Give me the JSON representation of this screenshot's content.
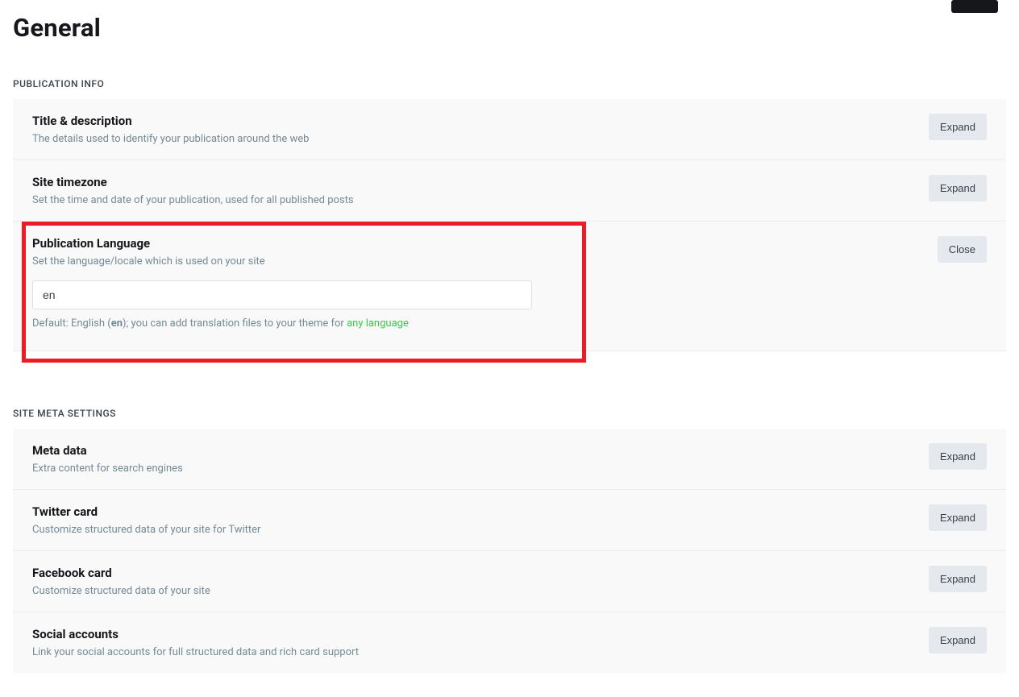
{
  "page": {
    "title": "General"
  },
  "topbar": {
    "save_label": ""
  },
  "sections": [
    {
      "label": "PUBLICATION INFO",
      "rows": [
        {
          "title": "Title & description",
          "desc": "The details used to identify your publication around the web",
          "action": "Expand"
        },
        {
          "title": "Site timezone",
          "desc": "Set the time and date of your publication, used for all published posts",
          "action": "Expand"
        }
      ],
      "expanded": {
        "title": "Publication Language",
        "desc": "Set the language/locale which is used on your site",
        "action": "Close",
        "input_value": "en",
        "help_prefix": "Default: English (",
        "help_bold": "en",
        "help_middle": "); you can add translation files to your theme for ",
        "help_link_text": "any language"
      }
    },
    {
      "label": "SITE META SETTINGS",
      "rows": [
        {
          "title": "Meta data",
          "desc": "Extra content for search engines",
          "action": "Expand"
        },
        {
          "title": "Twitter card",
          "desc": "Customize structured data of your site for Twitter",
          "action": "Expand"
        },
        {
          "title": "Facebook card",
          "desc": "Customize structured data of your site",
          "action": "Expand"
        },
        {
          "title": "Social accounts",
          "desc": "Link your social accounts for full structured data and rich card support",
          "action": "Expand"
        }
      ]
    }
  ]
}
